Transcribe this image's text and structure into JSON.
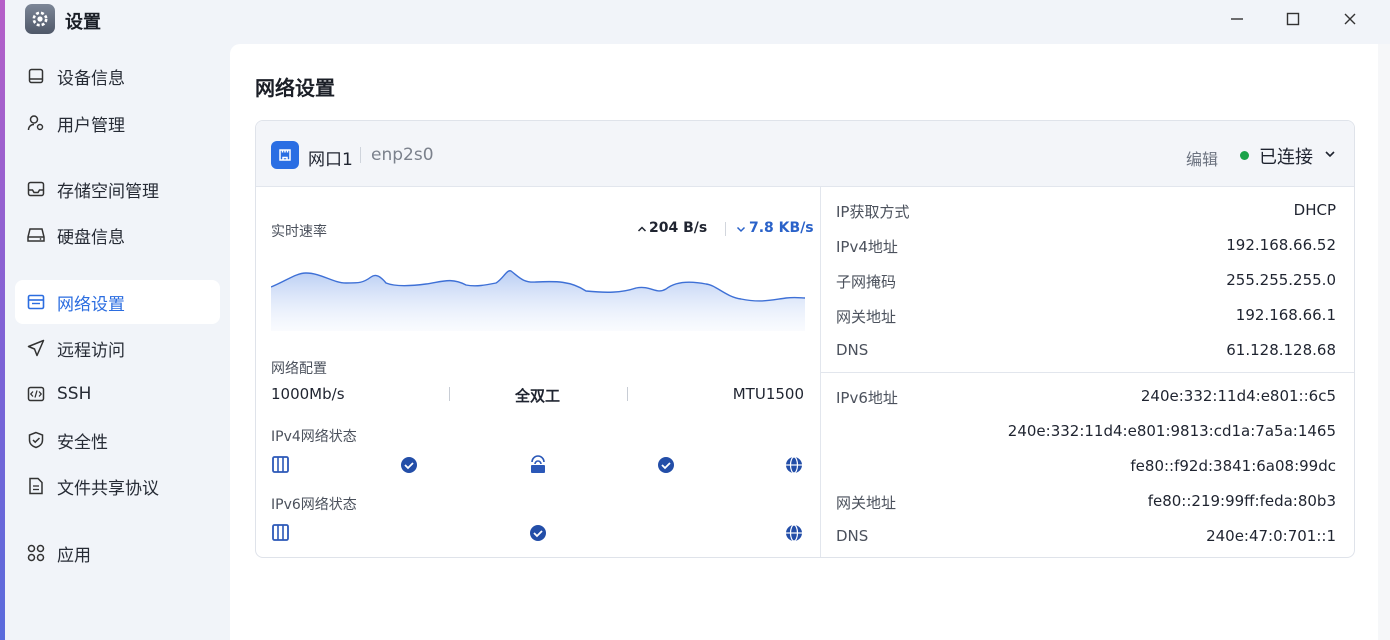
{
  "window": {
    "title": "设置",
    "icons": {
      "app": "gear-icon",
      "minimize": "minimize-icon",
      "maximize": "maximize-icon",
      "close": "close-icon"
    }
  },
  "sidebar": {
    "items": [
      {
        "label": "设备信息",
        "icon": "device-icon"
      },
      {
        "label": "用户管理",
        "icon": "user-gear-icon"
      },
      {
        "label": "存储空间管理",
        "icon": "inbox-icon"
      },
      {
        "label": "硬盘信息",
        "icon": "drive-icon"
      },
      {
        "label": "网络设置",
        "icon": "window-icon",
        "active": true
      },
      {
        "label": "远程访问",
        "icon": "send-icon"
      },
      {
        "label": "SSH",
        "icon": "code-icon"
      },
      {
        "label": "安全性",
        "icon": "shield-icon"
      },
      {
        "label": "文件共享协议",
        "icon": "document-icon"
      },
      {
        "label": "应用",
        "icon": "apps-grid-icon"
      }
    ]
  },
  "main": {
    "title": "网络设置",
    "port": {
      "name": "网口1",
      "device": "enp2s0",
      "edit_label": "编辑",
      "status": "已连接",
      "status_color": "#1aa34a"
    },
    "speed": {
      "label": "实时速率",
      "up": "204 B/s",
      "down": "7.8 KB/s"
    },
    "config": {
      "label": "网络配置",
      "speed": "1000Mb/s",
      "duplex": "全双工",
      "mtu": "MTU1500"
    },
    "ipv4_status": {
      "label": "IPv4网络状态"
    },
    "ipv6_status": {
      "label": "IPv6网络状态"
    },
    "ipv4": {
      "method_label": "IP获取方式",
      "method": "DHCP",
      "addr_label": "IPv4地址",
      "addr": "192.168.66.52",
      "mask_label": "子网掩码",
      "mask": "255.255.255.0",
      "gw_label": "网关地址",
      "gw": "192.168.66.1",
      "dns_label": "DNS",
      "dns": "61.128.128.68"
    },
    "ipv6": {
      "addr_label": "IPv6地址",
      "addrs": [
        "240e:332:11d4:e801::6c5",
        "240e:332:11d4:e801:9813:cd1a:7a5a:1465",
        "fe80::f92d:3841:6a08:99dc"
      ],
      "gw_label": "网关地址",
      "gw": "fe80::219:99ff:feda:80b3",
      "dns_label": "DNS",
      "dns": "240e:47:0:701::1"
    }
  },
  "colors": {
    "accent": "#2b6de0",
    "connected": "#1aa34a"
  }
}
